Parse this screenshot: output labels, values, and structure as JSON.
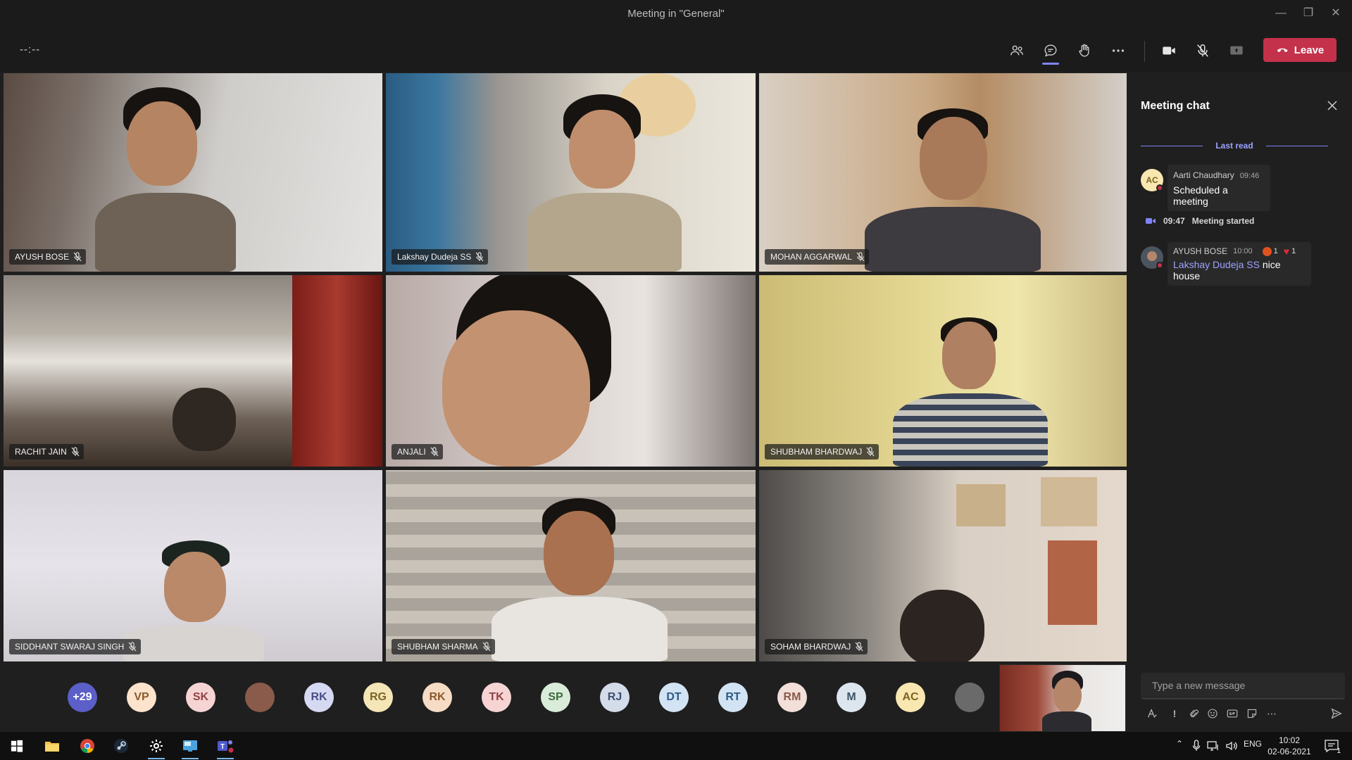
{
  "window": {
    "title": "Meeting in \"General\""
  },
  "toolbar": {
    "timer": "--:--",
    "leave_label": "Leave",
    "icons": [
      "people-icon",
      "chat-icon",
      "raise-hand-icon",
      "more-icon",
      "camera-icon",
      "mic-muted-icon",
      "share-screen-icon"
    ]
  },
  "tiles": [
    {
      "name": "AYUSH BOSE"
    },
    {
      "name": "Lakshay Dudeja SS"
    },
    {
      "name": "MOHAN AGGARWAL"
    },
    {
      "name": "RACHIT JAIN"
    },
    {
      "name": "ANJALI"
    },
    {
      "name": "SHUBHAM BHARDWAJ"
    },
    {
      "name": "SIDDHANT SWARAJ SINGH"
    },
    {
      "name": "SHUBHAM SHARMA"
    },
    {
      "name": "SOHAM BHARDWAJ"
    }
  ],
  "participants": {
    "overflow": "+29",
    "avatars": [
      {
        "initials": "VP",
        "bg": "#fbe3cc",
        "fg": "#8a5a2b"
      },
      {
        "initials": "SK",
        "bg": "#f7d4d4",
        "fg": "#8f4444"
      },
      {
        "initials": "",
        "bg": "#8a5a4a",
        "fg": "#ffffff"
      },
      {
        "initials": "RK",
        "bg": "#d6d9f2",
        "fg": "#4a4f8a"
      },
      {
        "initials": "RG",
        "bg": "#f5e6b8",
        "fg": "#7c6420"
      },
      {
        "initials": "RK",
        "bg": "#f6dcc5",
        "fg": "#8a5a2b"
      },
      {
        "initials": "TK",
        "bg": "#f7d4d4",
        "fg": "#8f4444"
      },
      {
        "initials": "SP",
        "bg": "#d9ecd9",
        "fg": "#3e6b3e"
      },
      {
        "initials": "RJ",
        "bg": "#d4dcea",
        "fg": "#3e5070"
      },
      {
        "initials": "DT",
        "bg": "#d2e4f4",
        "fg": "#2f5a85"
      },
      {
        "initials": "RT",
        "bg": "#d2e4f4",
        "fg": "#2f5a85"
      },
      {
        "initials": "RM",
        "bg": "#f2dfd9",
        "fg": "#8a5a4a"
      },
      {
        "initials": "M",
        "bg": "#dde6ee",
        "fg": "#3e5566"
      },
      {
        "initials": "AC",
        "bg": "#f8e7b0",
        "fg": "#7c6420"
      },
      {
        "initials": "",
        "bg": "#6a6a6a",
        "fg": "#ffffff"
      }
    ]
  },
  "chat": {
    "title": "Meeting chat",
    "last_read": "Last read",
    "messages": [
      {
        "avatar": "AC",
        "author": "Aarti Chaudhary",
        "time": "09:46",
        "text": "Scheduled a meeting"
      },
      {
        "avatar": "",
        "author": "AYUSH BOSE",
        "time": "10:00",
        "mention": "Lakshay Dudeja SS",
        "text": "nice house",
        "reactions": [
          {
            "icon": "angry-emoji-icon",
            "count": "1"
          },
          {
            "icon": "heart-icon",
            "count": "1"
          }
        ]
      }
    ],
    "system": {
      "time": "09:47",
      "text": "Meeting started"
    },
    "compose_placeholder": "Type a new message",
    "compose_tools": [
      "format-icon",
      "important-icon",
      "attach-icon",
      "emoji-icon",
      "gif-icon",
      "sticker-icon",
      "more-icon",
      "send-icon"
    ]
  },
  "taskbar": {
    "language": "ENG",
    "time": "10:02",
    "date": "02-06-2021",
    "notification_count": "1"
  }
}
